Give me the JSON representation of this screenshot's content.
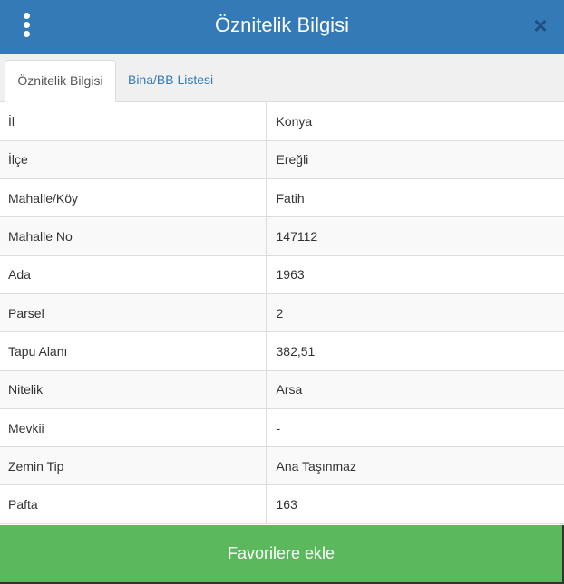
{
  "header": {
    "title": "Öznitelik Bilgisi",
    "close_glyph": "×"
  },
  "tabs": [
    {
      "label": "Öznitelik Bilgisi",
      "active": true
    },
    {
      "label": "Bina/BB Listesi",
      "active": false
    }
  ],
  "attributes": [
    {
      "key": "İl",
      "value": "Konya"
    },
    {
      "key": "İlçe",
      "value": "Ereğli"
    },
    {
      "key": "Mahalle/Köy",
      "value": "Fatih"
    },
    {
      "key": "Mahalle No",
      "value": "147112"
    },
    {
      "key": "Ada",
      "value": "1963"
    },
    {
      "key": "Parsel",
      "value": "2"
    },
    {
      "key": "Tapu Alanı",
      "value": "382,51"
    },
    {
      "key": "Nitelik",
      "value": "Arsa"
    },
    {
      "key": "Mevkii",
      "value": "-"
    },
    {
      "key": "Zemin Tip",
      "value": "Ana Taşınmaz"
    },
    {
      "key": "Pafta",
      "value": "163"
    }
  ],
  "footer": {
    "button_label": "Favorilere ekle"
  },
  "colors": {
    "header": "#337ab7",
    "footer": "#5cb85c",
    "tab_link": "#337ab7"
  }
}
